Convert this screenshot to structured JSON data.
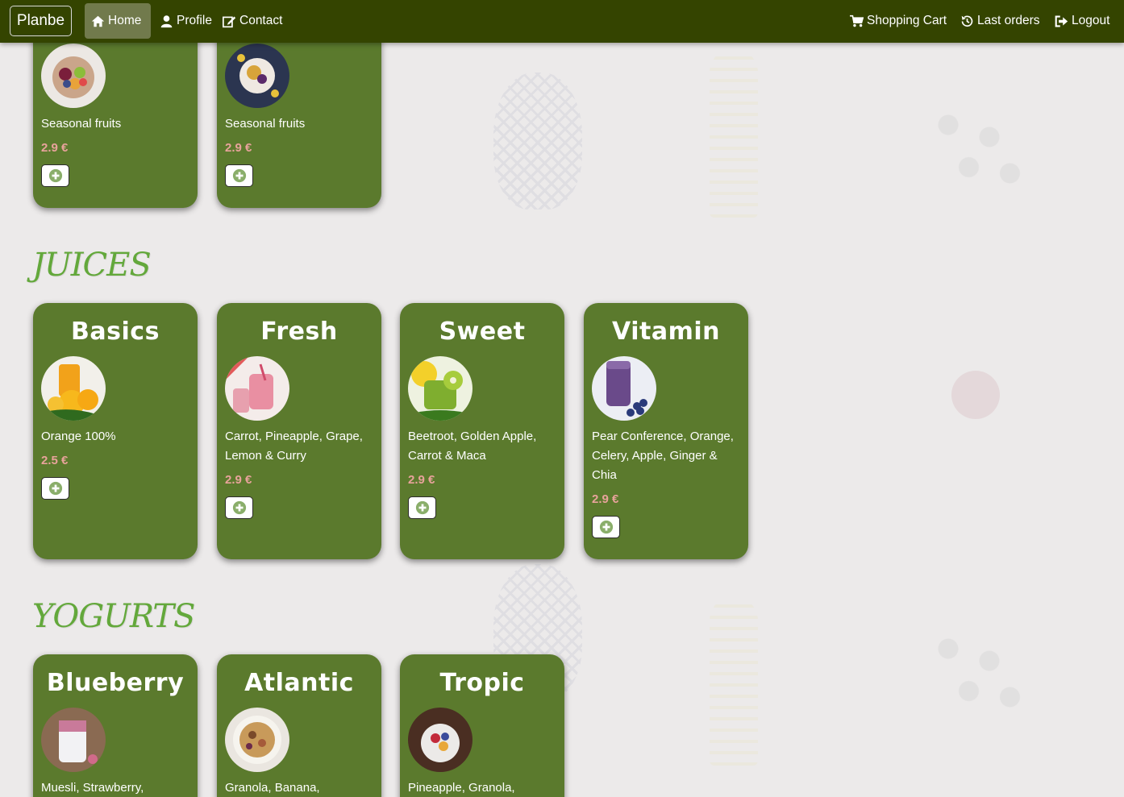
{
  "navbar": {
    "brand": "Planbe",
    "left_items": [
      {
        "label": "Home",
        "icon": "home-icon",
        "active": true
      },
      {
        "label": "Profile",
        "icon": "user-icon"
      },
      {
        "label": "Contact",
        "icon": "edit-icon"
      }
    ],
    "right_items": [
      {
        "label": "Shopping Cart",
        "icon": "cart-icon"
      },
      {
        "label": "Last orders",
        "icon": "history-icon"
      },
      {
        "label": "Logout",
        "icon": "logout-icon"
      }
    ]
  },
  "colors": {
    "navbar_bg": "#344400",
    "card_bg": "#5b7a2d",
    "section_title": "#63a83b",
    "price": "#e8a39b"
  },
  "top_cards": [
    {
      "desc": "Seasonal fruits",
      "price": "2.9 €",
      "image": "fruit-plate"
    },
    {
      "desc": "Seasonal fruits",
      "price": "2.9 €",
      "image": "fruit-bowl"
    }
  ],
  "juices": {
    "title": "JUICES",
    "cards": [
      {
        "title": "Basics",
        "desc": "Orange 100%",
        "price": "2.5 €",
        "image": "orange-juice"
      },
      {
        "title": "Fresh",
        "desc": "Carrot, Pineapple, Grape, Lemon & Curry",
        "price": "2.9 €",
        "image": "pink-juice"
      },
      {
        "title": "Sweet",
        "desc": "Beetroot, Golden Apple, Carrot & Maca",
        "price": "2.9 €",
        "image": "kiwi-juice"
      },
      {
        "title": "Vitamin",
        "desc": "Pear Conference, Orange, Celery, Apple, Ginger & Chia",
        "price": "2.9 €",
        "image": "blueberry-smoothie"
      }
    ]
  },
  "yogurts": {
    "title": "YOGURTS",
    "cards": [
      {
        "title": "Blueberry",
        "desc": "Muesli, Strawberry,",
        "image": "yogurt-jar"
      },
      {
        "title": "Atlantic",
        "desc": "Granola, Banana,",
        "image": "granola-bowl"
      },
      {
        "title": "Tropic",
        "desc": "Pineapple, Granola,",
        "image": "tropic-bowl"
      }
    ]
  }
}
